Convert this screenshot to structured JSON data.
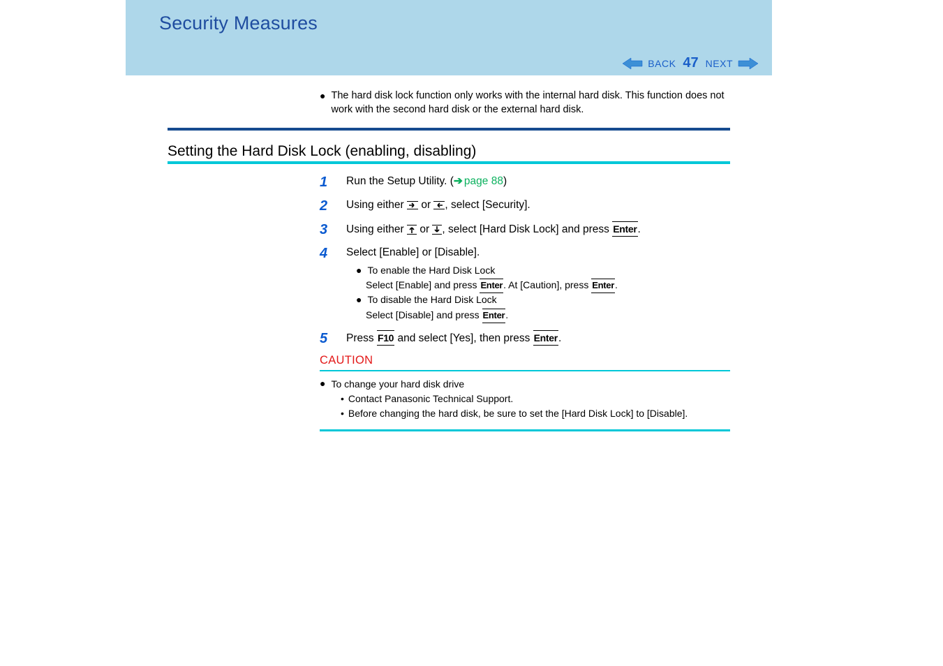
{
  "header": {
    "title": "Security Measures",
    "back_label": "BACK",
    "next_label": "NEXT",
    "page_number": "47"
  },
  "intro_note": "The hard disk lock function only works with the internal hard disk.  This function does not work with the second hard disk or the external hard disk.",
  "section_heading": "Setting the Hard Disk Lock (enabling, disabling)",
  "steps": {
    "s1": {
      "num": "1",
      "text_a": "Run the Setup Utility. (",
      "link_text": "page 88",
      "text_b": ")"
    },
    "s2": {
      "num": "2",
      "text_a": "Using either ",
      "text_mid": " or ",
      "text_b": ", select [Security]."
    },
    "s3": {
      "num": "3",
      "text_a": "Using either ",
      "text_mid": " or ",
      "text_b": ", select [Hard Disk Lock] and press ",
      "key": "Enter",
      "text_c": "."
    },
    "s4": {
      "num": "4",
      "heading": "Select [Enable] or [Disable].",
      "b1_title": "To enable the Hard Disk Lock",
      "b1_text_a": "Select [Enable] and press ",
      "b1_key1": "Enter",
      "b1_text_b": ".   At [Caution], press ",
      "b1_key2": "Enter",
      "b1_text_c": ".",
      "b2_title": "To disable the Hard Disk Lock",
      "b2_text_a": "Select [Disable] and press ",
      "b2_key": "Enter",
      "b2_text_b": "."
    },
    "s5": {
      "num": "5",
      "text_a": "Press ",
      "key1": "F10",
      "text_b": " and select [Yes], then press ",
      "key2": "Enter",
      "text_c": "."
    }
  },
  "caution": {
    "label": "CAUTION",
    "main": "To change your hard disk drive",
    "sub1": "Contact Panasonic Technical Support.",
    "sub2": "Before changing the hard disk, be sure to set the [Hard Disk Lock] to [Disable]."
  }
}
